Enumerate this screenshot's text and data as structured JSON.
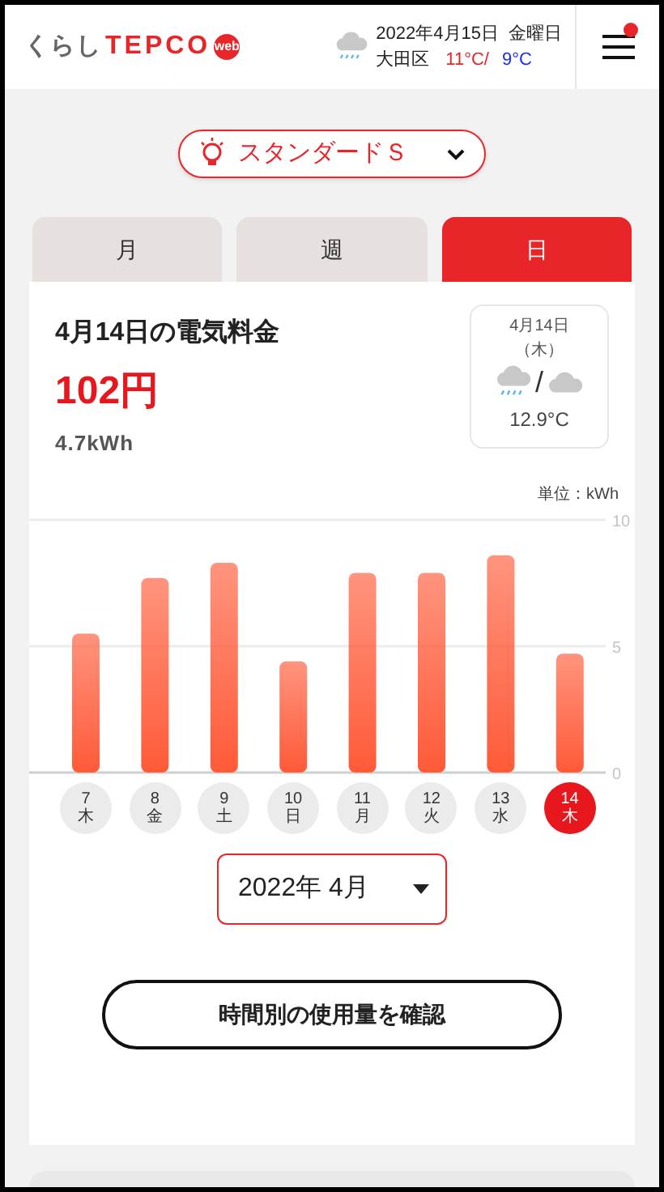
{
  "header": {
    "logo": {
      "prefix": "くらし",
      "brand": "TEPCO",
      "badge": "web"
    },
    "weather": {
      "date": "2022年4月15日",
      "weekday": "金曜日",
      "area": "大田区",
      "high": "11°C/",
      "low": "9°C"
    },
    "menu": {
      "notification": true
    }
  },
  "plan_selector": {
    "label": "スタンダードＳ"
  },
  "tabs": [
    {
      "label": "月",
      "selected": false
    },
    {
      "label": "週",
      "selected": false
    },
    {
      "label": "日",
      "selected": true
    }
  ],
  "summary": {
    "title": "4月14日の電気料金",
    "price": "102円",
    "usage": "4.7kWh"
  },
  "weather_card": {
    "date": "4月14日",
    "weekday": "（木）",
    "separator": "/",
    "temperature": "12.9°C"
  },
  "chart": {
    "unit": "単位：kWh",
    "chart_data": {
      "type": "bar",
      "categories": [
        "7",
        "8",
        "9",
        "10",
        "11",
        "12",
        "13",
        "14"
      ],
      "series": [
        {
          "color": "#ff5a38",
          "values": [
            5.5,
            7.7,
            8.3,
            4.4,
            7.9,
            7.9,
            8.6,
            4.7
          ]
        }
      ],
      "ylim": [
        0,
        10
      ],
      "yticks": [
        0,
        5,
        10
      ]
    }
  },
  "days": [
    {
      "weekday": "木",
      "selected": false
    },
    {
      "weekday": "金",
      "selected": false
    },
    {
      "weekday": "土",
      "selected": false
    },
    {
      "weekday": "日",
      "selected": false
    },
    {
      "weekday": "月",
      "selected": false
    },
    {
      "weekday": "火",
      "selected": false
    },
    {
      "weekday": "水",
      "selected": false
    },
    {
      "weekday": "木",
      "selected": true
    }
  ],
  "month_select": {
    "value": "2022年 4月"
  },
  "hourly_button": {
    "label": "時間別の使用量を確認"
  }
}
